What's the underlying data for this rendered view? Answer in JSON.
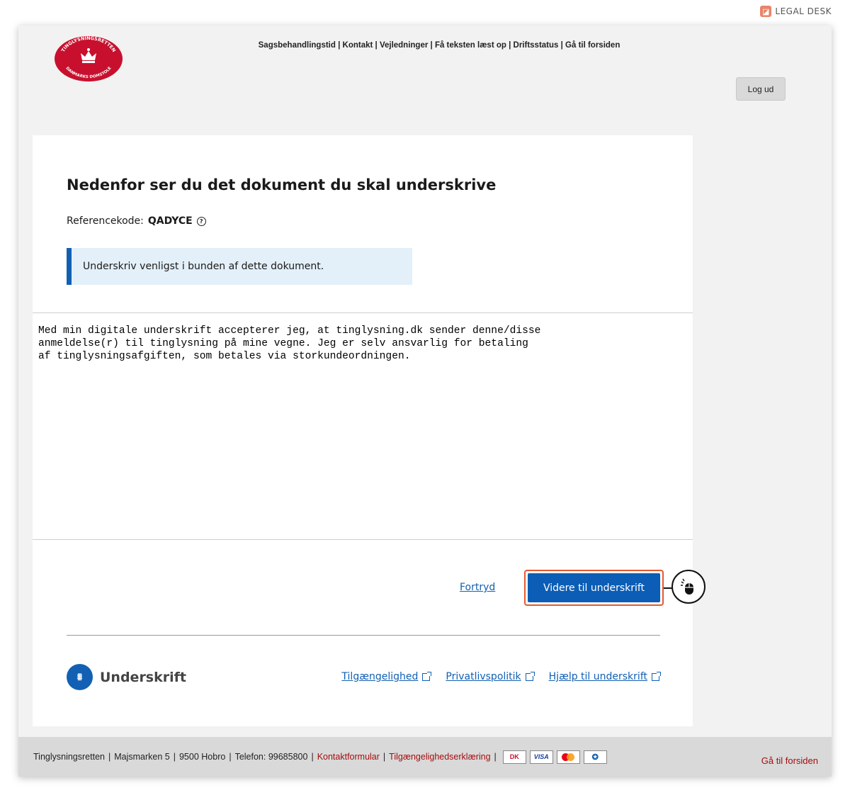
{
  "brand": {
    "label": "LEGAL DESK",
    "icon": "legal-desk-logo"
  },
  "header": {
    "logo": {
      "top_text": "TINGLYSNINGSRETTEN",
      "bottom_text": "DANMARKS DOMSTOLE"
    },
    "links": [
      "Sagsbehandlingstid",
      "Kontakt",
      "Vejledninger",
      "Få teksten læst op",
      "Driftsstatus",
      "Gå til forsiden"
    ],
    "logout_label": "Log ud"
  },
  "main": {
    "heading": "Nedenfor ser du det dokument du skal underskrive",
    "reference_label": "Referencekode:",
    "reference_code": "QADYCE",
    "notice": "Underskriv venligst i bunden af dette dokument.",
    "document_text": "Med min digitale underskrift accepterer jeg, at tinglysning.dk sender denne/disse\nanmeldelse(r) til tinglysning på mine vegne. Jeg er selv ansvarlig for betaling\naf tinglysningsafgiften, som betales via storkundeordningen.",
    "cancel_label": "Fortryd",
    "continue_label": "Videre til underskrift"
  },
  "signature_footer": {
    "brand_label": "Underskrift",
    "links": [
      "Tilgængelighed",
      "Privatlivspolitik",
      "Hjælp til underskrift"
    ]
  },
  "site_footer": {
    "items": [
      "Tinglysningsretten",
      "Majsmarken 5",
      "9500 Hobro",
      "Telefon: 99685800"
    ],
    "red_links": [
      "Kontaktformular",
      "Tilgængelighedserklæring"
    ],
    "cards": [
      "DK",
      "VISA",
      "MasterCard",
      "e-mærket"
    ],
    "home_link": "Gå til forsiden"
  },
  "colors": {
    "primary": "#0b5db6",
    "highlight": "#e35a2f",
    "notice_bg": "#e3f0f9",
    "footer_link": "#a50d0d"
  }
}
